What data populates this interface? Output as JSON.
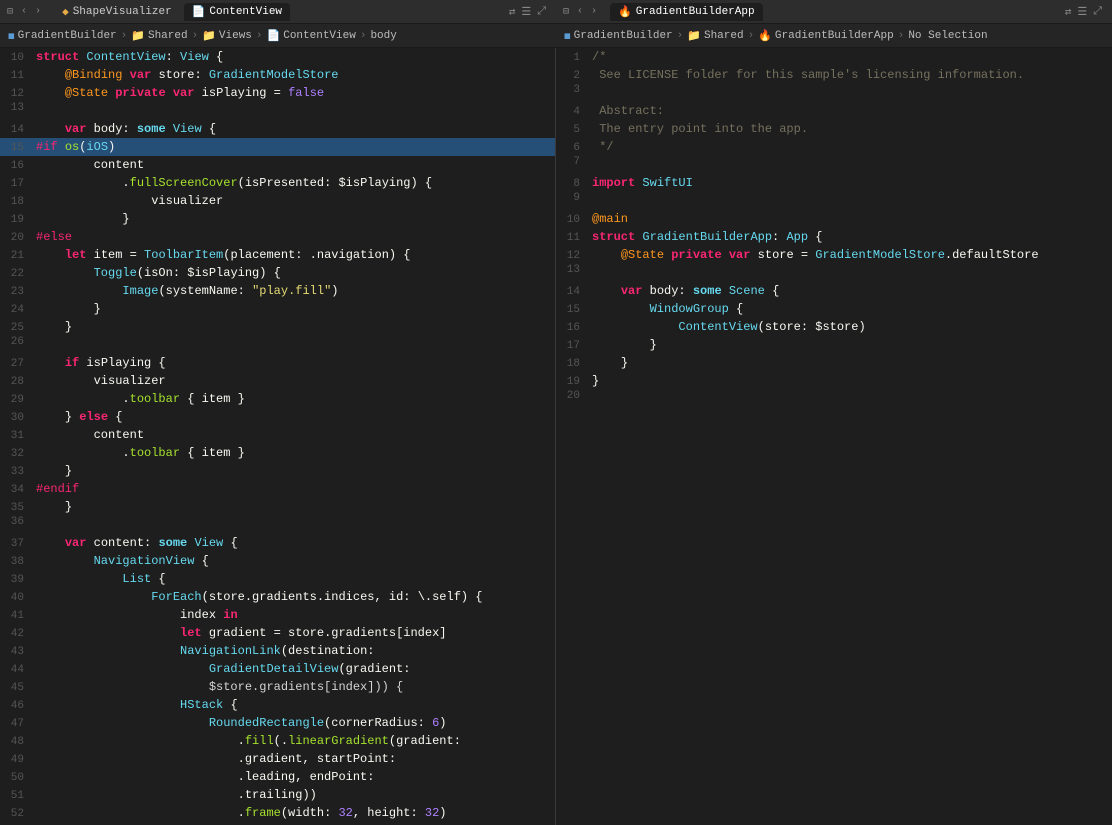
{
  "left_tab": {
    "icon": "🔸",
    "label": "ShapeVisualizer",
    "second_icon": "📄",
    "second_label": "ContentView"
  },
  "right_tab": {
    "icon": "🔥",
    "label": "GradientBuilderApp",
    "active": true
  },
  "left_breadcrumb": {
    "items": [
      "GradientBuilder",
      "Shared",
      "Views",
      "ContentView",
      "body"
    ]
  },
  "right_breadcrumb": {
    "items": [
      "GradientBuilder",
      "Shared",
      "GradientBuilderApp",
      "No Selection"
    ]
  },
  "left_code_lines": [
    {
      "num": 10,
      "html": "<span class='kw'>struct</span> <span class='type'>ContentView</span><span class='plain'>: </span><span class='type'>View</span><span class='plain'> {</span>"
    },
    {
      "num": 11,
      "html": "    <span class='attr'>@Binding</span> <span class='kw'>var</span> <span class='plain'>store: </span><span class='type'>GradientModelStore</span>"
    },
    {
      "num": 12,
      "html": "    <span class='attr'>@State</span> <span class='kw'>private</span> <span class='kw'>var</span> <span class='plain'>isPlaying = </span><span class='bool'>false</span>"
    },
    {
      "num": 13,
      "html": ""
    },
    {
      "num": 14,
      "html": "    <span class='kw'>var</span> <span class='plain'>body: </span><span class='kw2'>some</span> <span class='type'>View</span><span class='plain'> {</span>"
    },
    {
      "num": 15,
      "html": "<span class='preproc'>#if</span><span class='plain'> </span><span class='func-call'>os</span><span class='plain'>(</span><span class='type'>iOS</span><span class='plain'>)</span>",
      "highlight": true
    },
    {
      "num": 16,
      "html": "        <span class='plain'>content</span>"
    },
    {
      "num": 17,
      "html": "            <span class='plain'>.</span><span class='func-call'>fullScreenCover</span><span class='plain'>(isPresented: </span><span class='plain'>$isPlaying) {</span>"
    },
    {
      "num": 18,
      "html": "                <span class='plain'>visualizer</span>"
    },
    {
      "num": 19,
      "html": "            <span class='plain'>}</span>"
    },
    {
      "num": 20,
      "html": "<span class='preproc'>#else</span>"
    },
    {
      "num": 21,
      "html": "    <span class='kw'>let</span> <span class='plain'>item = </span><span class='type'>ToolbarItem</span><span class='plain'>(placement: .</span><span class='plain'>navigation) {</span>"
    },
    {
      "num": 22,
      "html": "        <span class='type'>Toggle</span><span class='plain'>(isOn: $isPlaying) {</span>"
    },
    {
      "num": 23,
      "html": "            <span class='type'>Image</span><span class='plain'>(systemName: </span><span class='str'>\"play.fill\"</span><span class='plain'>)</span>"
    },
    {
      "num": 24,
      "html": "        <span class='plain'>}</span>"
    },
    {
      "num": 25,
      "html": "    <span class='plain'>}</span>"
    },
    {
      "num": 26,
      "html": ""
    },
    {
      "num": 27,
      "html": "    <span class='kw'>if</span> <span class='plain'>isPlaying {</span>"
    },
    {
      "num": 28,
      "html": "        <span class='plain'>visualizer</span>"
    },
    {
      "num": 29,
      "html": "            <span class='plain'>.</span><span class='func-call'>toolbar</span><span class='plain'> { item }</span>"
    },
    {
      "num": 30,
      "html": "    <span class='plain'>} </span><span class='kw'>else</span><span class='plain'> {</span>"
    },
    {
      "num": 31,
      "html": "        <span class='plain'>content</span>"
    },
    {
      "num": 32,
      "html": "            <span class='plain'>.</span><span class='func-call'>toolbar</span><span class='plain'> { item }</span>"
    },
    {
      "num": 33,
      "html": "    <span class='plain'>}</span>"
    },
    {
      "num": 34,
      "html": "<span class='preproc'>#endif</span>"
    },
    {
      "num": 35,
      "html": "    <span class='plain'>}</span>"
    },
    {
      "num": 36,
      "html": ""
    },
    {
      "num": 37,
      "html": "    <span class='kw'>var</span> <span class='plain'>content: </span><span class='kw2'>some</span> <span class='type'>View</span><span class='plain'> {</span>"
    },
    {
      "num": 38,
      "html": "        <span class='type'>NavigationView</span><span class='plain'> {</span>"
    },
    {
      "num": 39,
      "html": "            <span class='type'>List</span><span class='plain'> {</span>"
    },
    {
      "num": 40,
      "html": "                <span class='type'>ForEach</span><span class='plain'>(store.gradients.indices, id: </span><span class='plain'>\\.self) {</span>"
    },
    {
      "num": 41,
      "html": "                    <span class='plain'>index </span><span class='kw'>in</span>"
    },
    {
      "num": 42,
      "html": "                    <span class='kw'>let</span> <span class='plain'>gradient = store.gradients[index]</span>"
    },
    {
      "num": 43,
      "html": "                    <span class='type'>NavigationLink</span><span class='plain'>(destination:</span>"
    },
    {
      "num": 44,
      "html": "                        <span class='type'>GradientDetailView</span><span class='plain'>(gradient:</span>"
    },
    {
      "num": 45,
      "html": "                        $store.gradients[index])) {</span>"
    },
    {
      "num": 46,
      "html": "                    <span class='type'>HStack</span><span class='plain'> {</span>"
    },
    {
      "num": 47,
      "html": "                        <span class='type'>RoundedRectangle</span><span class='plain'>(cornerRadius: </span><span class='num'>6</span><span class='plain'>)</span>"
    },
    {
      "num": 48,
      "html": "                            <span class='plain'>.</span><span class='func-call'>fill</span><span class='plain'>(.</span><span class='func-call'>linearGradient</span><span class='plain'>(gradient:</span>"
    },
    {
      "num": 49,
      "html": "                            <span class='plain'>.gradient, startPoint:</span>"
    },
    {
      "num": 50,
      "html": "                            <span class='plain'>.leading, endPoint:</span>"
    },
    {
      "num": 51,
      "html": "                            <span class='plain'>.trailing))</span>"
    },
    {
      "num": 52,
      "html": "                            <span class='plain'>.</span><span class='func-call'>frame</span><span class='plain'>(width: </span><span class='num'>32</span><span class='plain'>, height: </span><span class='num'>32</span><span class='plain'>)</span>"
    }
  ],
  "right_code_lines": [
    {
      "num": 1,
      "html": "<span class='comment'>/*</span>"
    },
    {
      "num": 2,
      "html": "<span class='comment'> See LICENSE folder for this sample's licensing information.</span>"
    },
    {
      "num": 3,
      "html": "<span class='comment'></span>"
    },
    {
      "num": 4,
      "html": "<span class='comment'> Abstract:</span>"
    },
    {
      "num": 5,
      "html": "<span class='comment'> The entry point into the app.</span>"
    },
    {
      "num": 6,
      "html": "<span class='comment'> */</span>"
    },
    {
      "num": 7,
      "html": ""
    },
    {
      "num": 8,
      "html": "<span class='swift-import'>import</span><span class='plain'> </span><span class='type'>SwiftUI</span>"
    },
    {
      "num": 9,
      "html": ""
    },
    {
      "num": 10,
      "html": "<span class='attr'>@main</span>"
    },
    {
      "num": 11,
      "html": "<span class='kw'>struct</span> <span class='type'>GradientBuilderApp</span><span class='plain'>: </span><span class='type'>App</span><span class='plain'> {</span>"
    },
    {
      "num": 12,
      "html": "    <span class='attr'>@State</span> <span class='kw'>private</span> <span class='kw'>var</span> <span class='plain'>store = </span><span class='type'>GradientModelStore</span><span class='plain'>.defaultStore</span>"
    },
    {
      "num": 13,
      "html": ""
    },
    {
      "num": 14,
      "html": "    <span class='kw'>var</span> <span class='plain'>body: </span><span class='kw2'>some</span> <span class='type'>Scene</span><span class='plain'> {</span>"
    },
    {
      "num": 15,
      "html": "        <span class='type'>WindowGroup</span><span class='plain'> {</span>"
    },
    {
      "num": 16,
      "html": "            <span class='type'>ContentView</span><span class='plain'>(store: $store)</span>"
    },
    {
      "num": 17,
      "html": "        <span class='plain'>}</span>"
    },
    {
      "num": 18,
      "html": "    <span class='plain'>}</span>"
    },
    {
      "num": 19,
      "html": "<span class='plain'>}</span>"
    },
    {
      "num": 20,
      "html": ""
    }
  ]
}
